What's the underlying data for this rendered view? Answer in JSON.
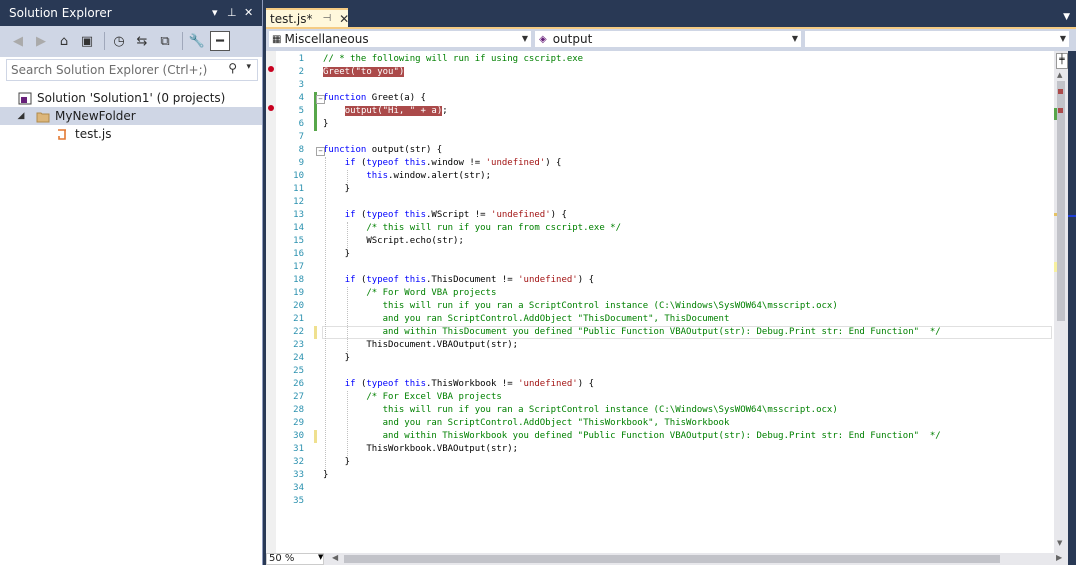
{
  "solution_explorer": {
    "title": "Solution Explorer",
    "search_placeholder": "Search Solution Explorer (Ctrl+;)",
    "tree": {
      "solution": "Solution 'Solution1' (0 projects)",
      "folder": "MyNewFolder",
      "file": "test.js"
    }
  },
  "editor": {
    "tab_label": "test.js*",
    "nav": {
      "left": "Miscellaneous",
      "middle": "output",
      "right": ""
    },
    "zoom": "50 %"
  },
  "colors": {
    "accent": "#293955",
    "tab": "#fff8dc",
    "breakpoint": "#c8001f",
    "breakpoint_highlight": "#ab4a4a"
  },
  "code_lines": [
    {
      "n": "1",
      "text": "// * the following will run if using cscript.exe"
    },
    {
      "n": "2",
      "text": "Greet(\"to you\")"
    },
    {
      "n": "3",
      "text": ""
    },
    {
      "n": "4",
      "text": "function Greet(a) {"
    },
    {
      "n": "5",
      "text": "    output(\"Hi, \" + a);"
    },
    {
      "n": "6",
      "text": "}"
    },
    {
      "n": "7",
      "text": ""
    },
    {
      "n": "8",
      "text": "function output(str) {"
    },
    {
      "n": "9",
      "text": "    if (typeof this.window != 'undefined') {"
    },
    {
      "n": "10",
      "text": "        this.window.alert(str);"
    },
    {
      "n": "11",
      "text": "    }"
    },
    {
      "n": "12",
      "text": ""
    },
    {
      "n": "13",
      "text": "    if (typeof this.WScript != 'undefined') {"
    },
    {
      "n": "14",
      "text": "        /* this will run if you ran from cscript.exe */"
    },
    {
      "n": "15",
      "text": "        WScript.echo(str);"
    },
    {
      "n": "16",
      "text": "    }"
    },
    {
      "n": "17",
      "text": ""
    },
    {
      "n": "18",
      "text": "    if (typeof this.ThisDocument != 'undefined') {"
    },
    {
      "n": "19",
      "text": "        /* For Word VBA projects"
    },
    {
      "n": "20",
      "text": "           this will run if you ran a ScriptControl instance (C:\\Windows\\SysWOW64\\msscript.ocx)"
    },
    {
      "n": "21",
      "text": "           and you ran ScriptControl.AddObject \"ThisDocument\", ThisDocument"
    },
    {
      "n": "22",
      "text": "           and within ThisDocument you defined \"Public Function VBAOutput(str): Debug.Print str: End Function\"  */"
    },
    {
      "n": "23",
      "text": "        ThisDocument.VBAOutput(str);"
    },
    {
      "n": "24",
      "text": "    }"
    },
    {
      "n": "25",
      "text": ""
    },
    {
      "n": "26",
      "text": "    if (typeof this.ThisWorkbook != 'undefined') {"
    },
    {
      "n": "27",
      "text": "        /* For Excel VBA projects"
    },
    {
      "n": "28",
      "text": "           this will run if you ran a ScriptControl instance (C:\\Windows\\SysWOW64\\msscript.ocx)"
    },
    {
      "n": "29",
      "text": "           and you ran ScriptControl.AddObject \"ThisWorkbook\", ThisWorkbook"
    },
    {
      "n": "30",
      "text": "           and within ThisWorkbook you defined \"Public Function VBAOutput(str): Debug.Print str: End Function\"  */"
    },
    {
      "n": "31",
      "text": "        ThisWorkbook.VBAOutput(str);"
    },
    {
      "n": "32",
      "text": "    }"
    },
    {
      "n": "33",
      "text": "}"
    },
    {
      "n": "34",
      "text": ""
    },
    {
      "n": "35",
      "text": ""
    }
  ]
}
